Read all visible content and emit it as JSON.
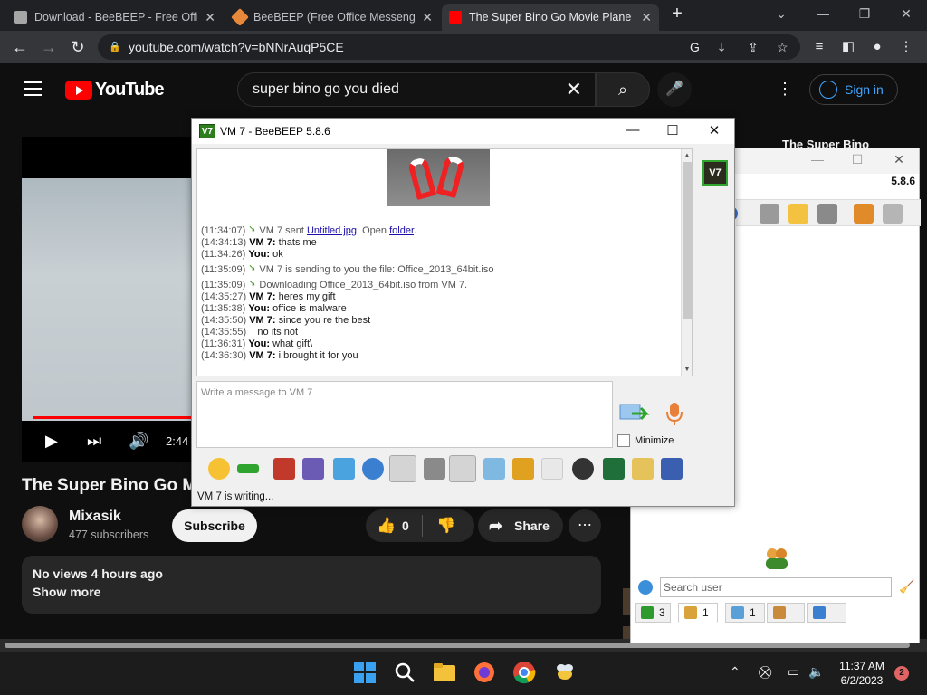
{
  "browser": {
    "tabs": [
      {
        "title": "Download - BeeBEEP - Free Offic",
        "favicon_color": "#a6a6a6"
      },
      {
        "title": "BeeBEEP (Free Office Messenger)",
        "favicon_color": "#e8883a"
      },
      {
        "title": "The Super Bino Go Movie Plane",
        "favicon_color": "#ff0000"
      }
    ],
    "new_tab": "+",
    "url": "youtube.com/watch?v=bNNrAuqP5CE"
  },
  "youtube": {
    "logo_text": "YouTube",
    "search_query": "super bino go you died",
    "sign_in": "Sign in",
    "player_time": "2:44",
    "video_title": "The Super Bino Go Mo",
    "side_title": "The Super Bino",
    "channel": "Mixasik",
    "subscribers": "477 subscribers",
    "subscribe": "Subscribe",
    "likes": "0",
    "share": "Share",
    "desc_meta": "No views  4 hours ago",
    "show_more": "Show more"
  },
  "chat": {
    "title": "VM 7 - BeeBEEP 5.8.6",
    "app_icon_text": "V7",
    "messages": [
      {
        "ts": "(11:34:07)",
        "who": "",
        "text": "VM 7 sent ",
        "link": "Untitled.jpg",
        "text2": ". Open ",
        "link2": "folder",
        "text3": ".",
        "icon": true
      },
      {
        "ts": "(14:34:13)",
        "who": "VM 7:",
        "text": " thats me"
      },
      {
        "ts": "(11:34:26)",
        "who": "You:",
        "text": " ok"
      },
      {
        "ts": "(11:35:09)",
        "who": "",
        "text": "VM 7 is sending to you the file: Office_2013_64bit.iso",
        "icon": true
      },
      {
        "ts": "(11:35:09)",
        "who": "",
        "text": "Downloading Office_2013_64bit.iso from VM 7.",
        "icon": true
      },
      {
        "ts": "(14:35:27)",
        "who": "VM 7:",
        "text": " heres my gift"
      },
      {
        "ts": "(11:35:38)",
        "who": "You:",
        "text": " office is malware"
      },
      {
        "ts": "(14:35:50)",
        "who": "VM 7:",
        "text": " since you re the best"
      },
      {
        "ts": "(14:35:55)",
        "who": "",
        "text": "    no its not"
      },
      {
        "ts": "(11:36:31)",
        "who": "You:",
        "text": " what gift\\"
      },
      {
        "ts": "(14:36:30)",
        "who": "VM 7:",
        "text": " i brought it for you"
      }
    ],
    "input_placeholder": "Write a message to VM 7",
    "minimize_label": "Minimize",
    "status": "VM 7 is writing...",
    "sidebar_badge": "V7"
  },
  "userlist": {
    "version": "5.8.6",
    "search_placeholder": "Search user",
    "tabs": [
      {
        "count": "3",
        "icon_color": "#2e9a2e"
      },
      {
        "count": "1",
        "icon_color": "#d9a23a"
      },
      {
        "count": "1",
        "icon_color": "#5aa0d8"
      },
      {
        "count": "",
        "icon_color": "#c98b3b"
      },
      {
        "count": "",
        "icon_color": "#3b7fd0"
      }
    ]
  },
  "taskbar": {
    "time": "11:37 AM",
    "date": "6/2/2023",
    "notifications": "2"
  },
  "colors": {
    "youtube_red": "#ff0000",
    "link_blue": "#3ea6ff",
    "beebeep_green": "#2fa52f"
  }
}
